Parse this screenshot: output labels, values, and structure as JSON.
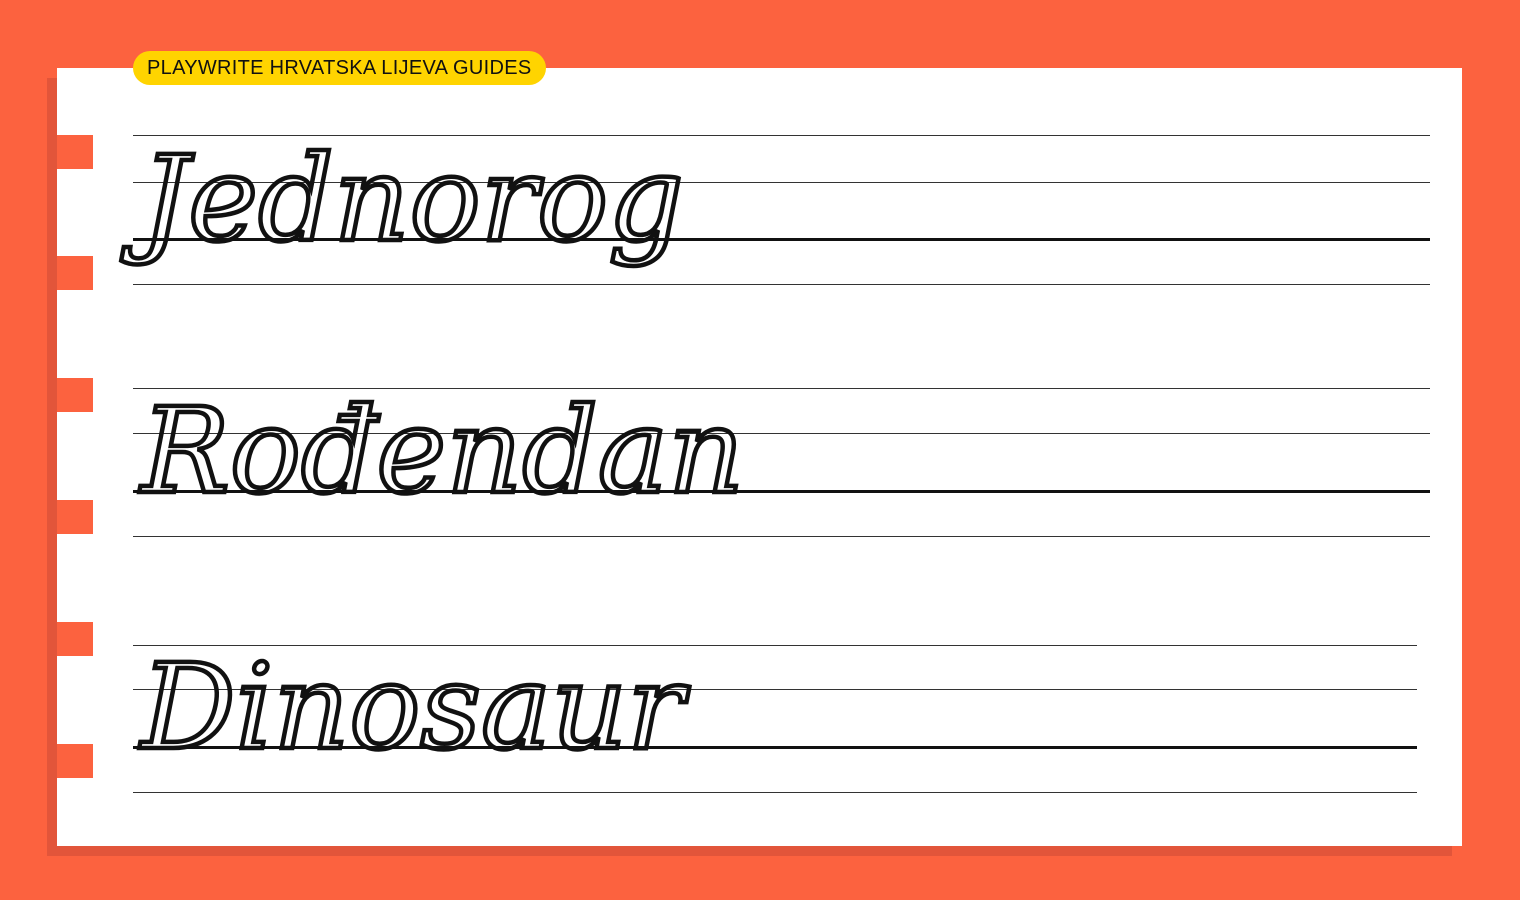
{
  "header": {
    "title": "PLAYWRITE HRVATSKA LIJEVA GUIDES"
  },
  "rows": [
    {
      "word": "Jednorog"
    },
    {
      "word": "Rođendan"
    },
    {
      "word": "Dinosaur"
    }
  ],
  "colors": {
    "background": "#FC623F",
    "paper": "#FFFFFF",
    "shadow": "#E2553A",
    "pill": "#FFD400",
    "ink": "#111111"
  }
}
